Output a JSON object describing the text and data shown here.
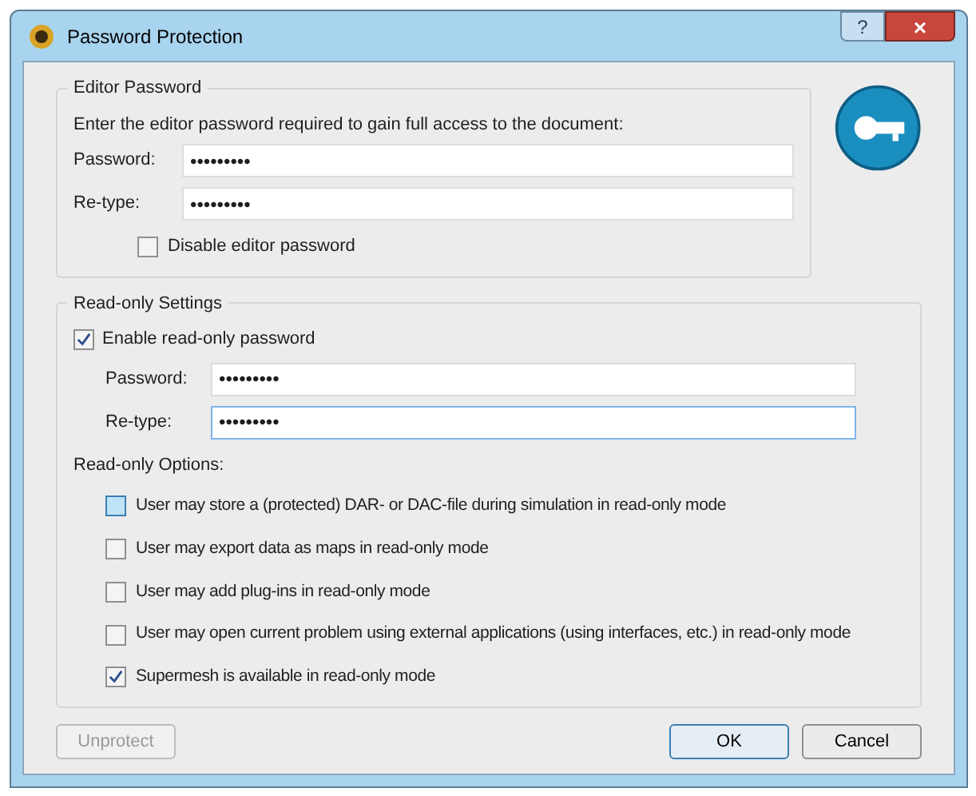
{
  "window": {
    "title": "Password Protection",
    "help_button": "?",
    "close_button": "×"
  },
  "editor_password": {
    "title": "Editor Password",
    "instruction": "Enter the editor password required to gain full access to the document:",
    "fields": [
      {
        "label": "Password:",
        "value": "•••••••••",
        "focused": false
      },
      {
        "label": "Re-type:",
        "value": "•••••••••",
        "focused": false
      }
    ],
    "disable": {
      "label": "Disable editor password",
      "checked": false
    }
  },
  "read_only_settings": {
    "title": "Read-only Settings",
    "enable": {
      "label": "Enable read-only password",
      "checked": true
    },
    "fields": [
      {
        "label": "Password:",
        "value": "•••••••••",
        "focused": false
      },
      {
        "label": "Re-type:",
        "value": "•••••••••",
        "focused": true
      }
    ],
    "options_label": "Read-only Options:",
    "options": [
      {
        "label": "User may store a (protected) DAR- or DAC-file during simulation in read-only mode",
        "checked": false,
        "hovered": true
      },
      {
        "label": "User may export data as maps in read-only mode",
        "checked": false,
        "hovered": false
      },
      {
        "label": "User may add plug-ins  in read-only mode",
        "checked": false,
        "hovered": false
      },
      {
        "label": "User may open current problem using external applications (using interfaces, etc.)  in read-only mode",
        "checked": false,
        "hovered": false
      },
      {
        "label": "Supermesh is available in read-only mode",
        "checked": true,
        "hovered": false
      }
    ]
  },
  "buttons": [
    {
      "label": "Unprotect",
      "disabled": true,
      "default": false
    },
    {
      "label": "OK",
      "disabled": false,
      "default": true
    },
    {
      "label": "Cancel",
      "disabled": false,
      "default": false
    }
  ]
}
